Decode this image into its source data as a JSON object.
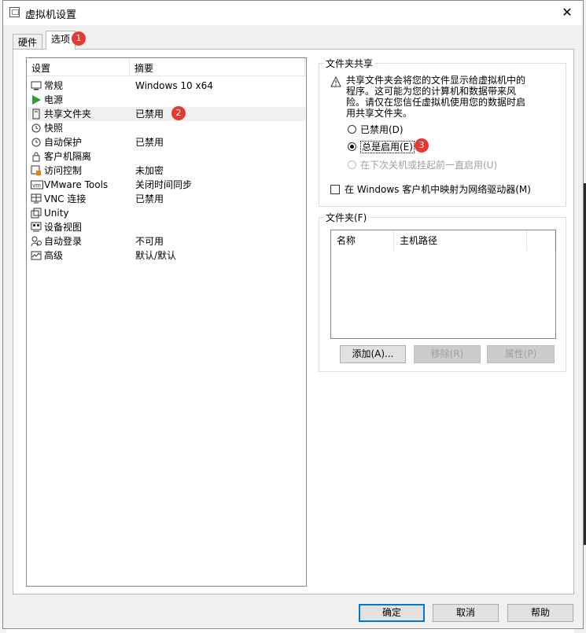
{
  "window": {
    "title": "虚拟机设置",
    "close_glyph": "✕"
  },
  "tabs": [
    {
      "label": "硬件"
    },
    {
      "label": "选项"
    }
  ],
  "badges": [
    "1",
    "2",
    "3"
  ],
  "settings_list": {
    "headers": [
      "设置",
      "摘要"
    ],
    "rows": [
      {
        "name": "常规",
        "summary": "Windows 10 x64",
        "icon": "monitor-icon"
      },
      {
        "name": "电源",
        "summary": "",
        "icon": "play-icon"
      },
      {
        "name": "共享文件夹",
        "summary": "已禁用",
        "icon": "shared-folder-icon"
      },
      {
        "name": "快照",
        "summary": "",
        "icon": "snapshot-icon"
      },
      {
        "name": "自动保护",
        "summary": "已禁用",
        "icon": "autoprotect-icon"
      },
      {
        "name": "客户机隔离",
        "summary": "",
        "icon": "lock-icon"
      },
      {
        "name": "访问控制",
        "summary": "未加密",
        "icon": "access-control-icon"
      },
      {
        "name": "VMware Tools",
        "summary": "关闭时间同步",
        "icon": "vmware-tools-icon"
      },
      {
        "name": "VNC 连接",
        "summary": "已禁用",
        "icon": "vnc-icon"
      },
      {
        "name": "Unity",
        "summary": "",
        "icon": "unity-icon"
      },
      {
        "name": "设备视图",
        "summary": "",
        "icon": "device-view-icon"
      },
      {
        "name": "自动登录",
        "summary": "不可用",
        "icon": "autologin-icon"
      },
      {
        "name": "高级",
        "summary": "默认/默认",
        "icon": "advanced-icon"
      }
    ]
  },
  "folder_sharing": {
    "title": "文件夹共享",
    "warning": "共享文件夹会将您的文件显示给虚拟机中的程序。这可能为您的计算机和数据带来风险。请仅在您信任虚拟机使用您的数据时启用共享文件夹。",
    "options": [
      {
        "label": "已禁用(D)",
        "checked": false,
        "disabled": false
      },
      {
        "label": "总是启用(E)",
        "checked": true,
        "disabled": false
      },
      {
        "label": "在下次关机或挂起前一直启用(U)",
        "checked": false,
        "disabled": true
      }
    ],
    "map_drive_label": "在 Windows 客户机中映射为网络驱动器(M)",
    "map_drive_checked": false
  },
  "folders": {
    "title": "文件夹(F)",
    "columns": [
      "名称",
      "主机路径"
    ],
    "buttons": {
      "add": "添加(A)...",
      "remove": "移除(R)",
      "properties": "属性(P)"
    }
  },
  "footer": {
    "ok": "确定",
    "cancel": "取消",
    "help": "帮助"
  },
  "colors": {
    "badge": "#e53935",
    "selection": "#e5f3ff",
    "default_button_border": "#0078d7"
  }
}
